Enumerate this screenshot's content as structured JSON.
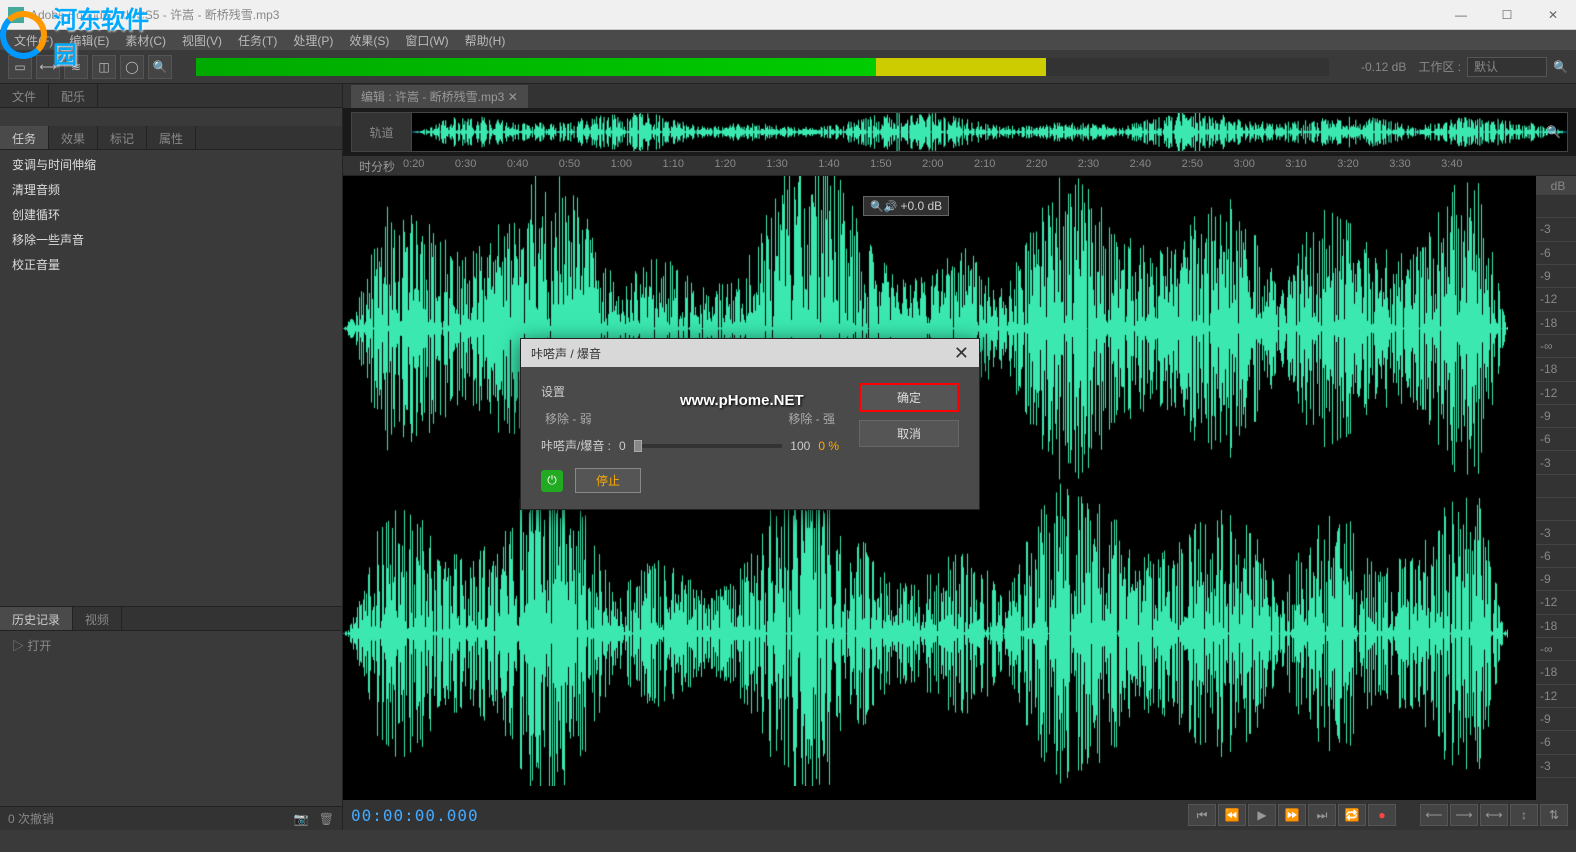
{
  "window": {
    "title": "Adobe Soundbooth CS5 - 许嵩 - 断桥残雪.mp3"
  },
  "menu": {
    "items": [
      "文件(F)",
      "编辑(E)",
      "素材(C)",
      "视图(V)",
      "任务(T)",
      "处理(P)",
      "效果(S)",
      "窗口(W)",
      "帮助(H)"
    ]
  },
  "toolbar": {
    "db_readout": "-0.12 dB",
    "workspace_label": "工作区 :",
    "workspace_value": "默认"
  },
  "sidebar": {
    "top_tabs": [
      "文件",
      "配乐"
    ],
    "task_tabs": [
      "任务",
      "效果",
      "标记",
      "属性"
    ],
    "tasks": [
      "变调与时间伸缩",
      "清理音频",
      "创建循环",
      "移除一些声音",
      "校正音量"
    ],
    "history_tabs": [
      "历史记录",
      "视频"
    ],
    "history_items": [
      "打开"
    ]
  },
  "editor": {
    "file_tab_prefix": "编辑 :",
    "file_name": "许嵩 - 断桥残雪.mp3",
    "overview_label": "轨道",
    "timeline_label": "时分秒",
    "ticks": [
      "0:20",
      "0:30",
      "0:40",
      "0:50",
      "1:00",
      "1:10",
      "1:20",
      "1:30",
      "1:40",
      "1:50",
      "2:00",
      "2:10",
      "2:20",
      "2:30",
      "2:40",
      "2:50",
      "3:00",
      "3:10",
      "3:20",
      "3:30",
      "3:40"
    ],
    "db_header": "dB",
    "db_marks_top": [
      "",
      "-3",
      "-6",
      "-9",
      "-12",
      "-18",
      "-∞",
      "-18",
      "-12",
      "-9",
      "-6",
      "-3",
      ""
    ],
    "zoom_badge": "+0.0 dB"
  },
  "transport": {
    "timecode": "00:00:00.000"
  },
  "status": {
    "undo_count": "0 次撤销"
  },
  "dialog": {
    "title": "咔嗒声 / 爆音",
    "settings_label": "设置",
    "remove_label": "移除 - 弱",
    "remove_right": "移除 - 强",
    "slider_label": "咔嗒声/爆音 :",
    "slider_min": "0",
    "slider_max": "100",
    "slider_value": "0 %",
    "ok": "确定",
    "cancel": "取消",
    "stop": "停止"
  },
  "watermark": {
    "logo_text": "河东软件园",
    "center_text": "www.pHome.NET"
  }
}
